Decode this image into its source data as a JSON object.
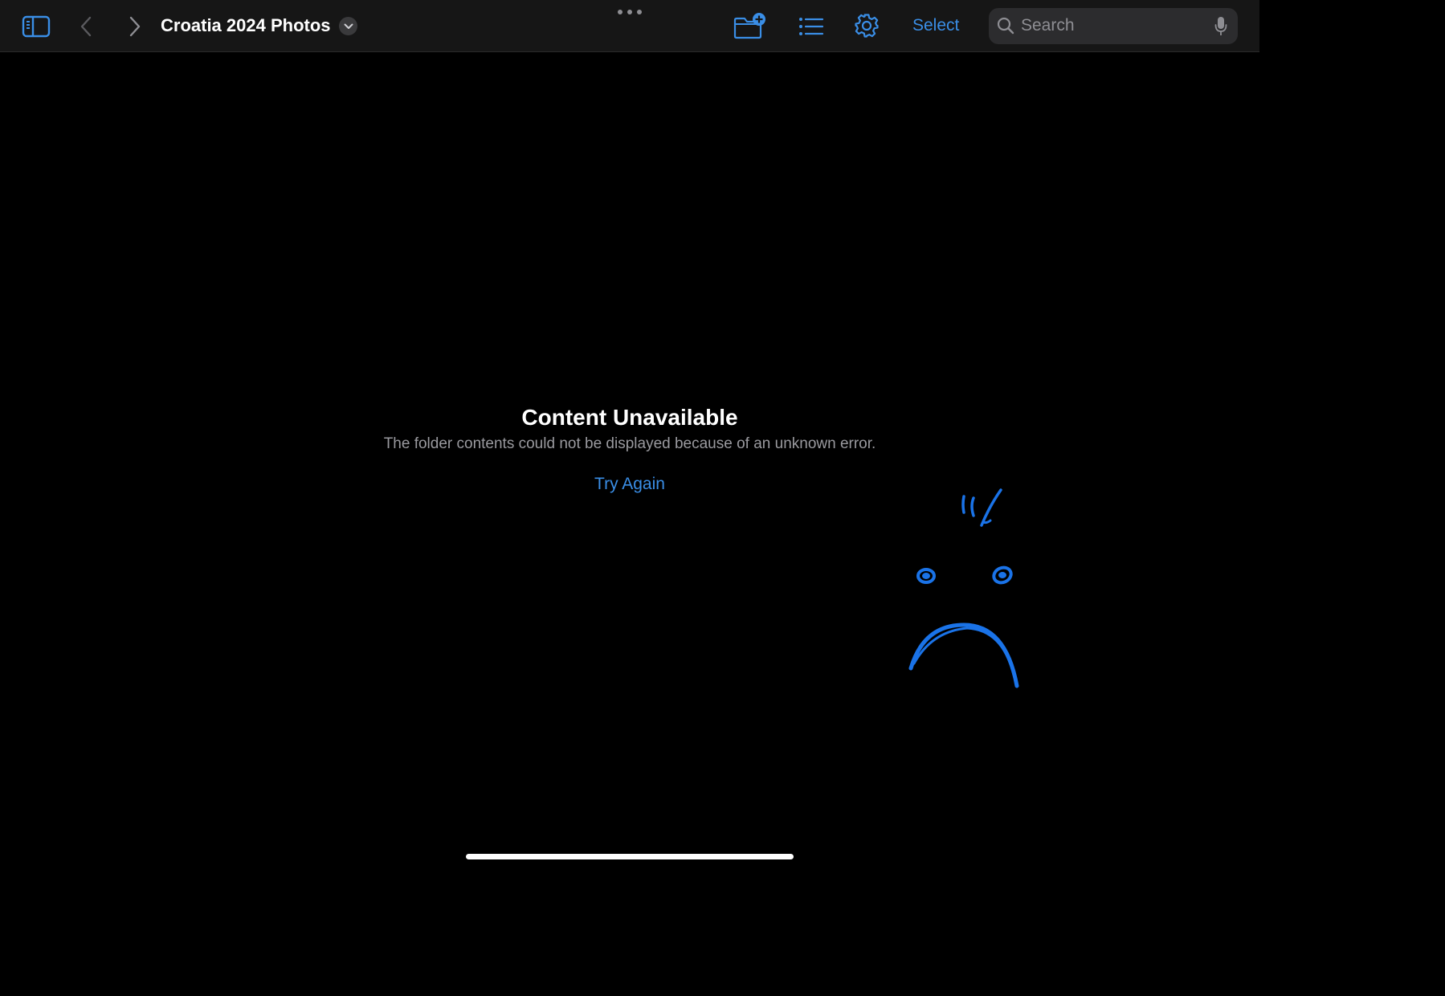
{
  "toolbar": {
    "title": "Croatia 2024 Photos",
    "select_label": "Select",
    "accent_color": "#3a8ee6",
    "icons": {
      "sidebar": "sidebar-toggle-icon",
      "back": "chevron-left-icon",
      "forward": "chevron-right-icon",
      "title_menu": "chevron-down-icon",
      "more": "more-dots-icon",
      "new_folder": "folder-badge-plus-icon",
      "view_options": "list-icon",
      "settings": "gear-icon"
    }
  },
  "search": {
    "placeholder": "Search",
    "value": "",
    "icons": {
      "search": "magnifier-icon",
      "dictation": "microphone-icon"
    }
  },
  "empty_state": {
    "title": "Content Unavailable",
    "message": "The folder contents could not be displayed because of an unknown error.",
    "action_label": "Try Again"
  },
  "annotation": {
    "description_icon": "sad-face-doodle-icon",
    "color": "#1a73e8"
  }
}
